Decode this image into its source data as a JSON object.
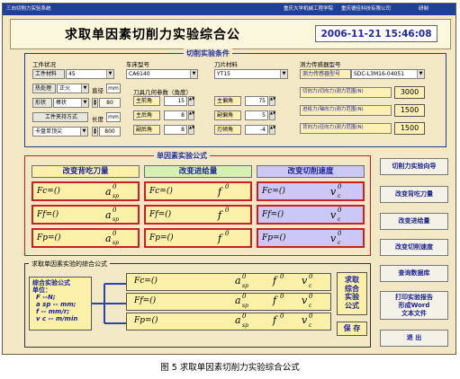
{
  "titlebar": {
    "app": "三向切削力实验系统",
    "org1": "重庆大学机械工程学院",
    "org2": "重庆德佳科技有限公司",
    "mode": "研制"
  },
  "header": {
    "title": "求取单因素切削力实验综合公",
    "datetime": "2006-11-21 15:46:08"
  },
  "conditions": {
    "title": "切削实验条件",
    "workpiece": {
      "label": "工件状况",
      "material_label": "工件材料",
      "material": "45",
      "heat_label": "热处理",
      "heat": "正火",
      "diameter_label": "直径",
      "diameter": "mm",
      "shape_label": "形状",
      "shape": "棒状",
      "shape_value": "80",
      "clamp_label": "工件夹持方式",
      "length_label": "长度",
      "length": "mm",
      "clamp": "卡盘单顶尖",
      "length_value": "800"
    },
    "lathe": {
      "label": "车床型号",
      "model": "CA6140"
    },
    "tool": {
      "label": "刀片材料",
      "material": "YT15"
    },
    "geometry": {
      "label": "刀具几何参数（角度）",
      "rows": [
        {
          "a_label": "主前角",
          "a_value": "15",
          "b_label": "主偏角",
          "b_value": "75"
        },
        {
          "a_label": "主后角",
          "a_value": "8",
          "b_label": "副偏角",
          "b_value": "5"
        },
        {
          "a_label": "副后角",
          "a_value": "8",
          "b_label": "刃倾角",
          "b_value": "-4"
        }
      ]
    },
    "sensor": {
      "label": "测力传感器型号",
      "model_label": "测力传感器型号",
      "model": "SDC-L3M16-04051",
      "ranges": [
        {
          "label": "切向力(切向力)测力范围(N)",
          "value": "3000"
        },
        {
          "label": "进给力(轴向力)测力范围(N)",
          "value": "1500"
        },
        {
          "label": "背向力(径向力)测力范围(N)",
          "value": "1500"
        }
      ]
    }
  },
  "single": {
    "title": "单因素实验公式",
    "columns": [
      {
        "header": "改变背吃刀量",
        "rows": [
          {
            "f": "Fc=()",
            "v": "a",
            "s": "sp",
            "p": "0"
          },
          {
            "f": "Ff=()",
            "v": "a",
            "s": "sp",
            "p": "0"
          },
          {
            "f": "Fp=()",
            "v": "a",
            "s": "sp",
            "p": "0"
          }
        ]
      },
      {
        "header": "改变进给量",
        "rows": [
          {
            "f": "Fc=()",
            "v": "f",
            "s": "",
            "p": "0"
          },
          {
            "f": "Ff=()",
            "v": "f",
            "s": "",
            "p": "0"
          },
          {
            "f": "Fp=()",
            "v": "f",
            "s": "",
            "p": "0"
          }
        ]
      },
      {
        "header": "改变切削速度",
        "rows": [
          {
            "f": "Fc=()",
            "v": "v",
            "s": "c",
            "p": "0"
          },
          {
            "f": "Ff=()",
            "v": "v",
            "s": "c",
            "p": "0"
          },
          {
            "f": "Fp=()",
            "v": "v",
            "s": "c",
            "p": "0"
          }
        ]
      }
    ]
  },
  "combined": {
    "title": "求取单因素实验的综合公式",
    "legend": [
      "综合实验公式",
      "单位：",
      "F --N;",
      "a sp -- mm;",
      "f -- mm/r;",
      "v c -- m/min"
    ],
    "rows": [
      {
        "f": "Fc=()",
        "t1": "a",
        "t1s": "sp",
        "t2": "f",
        "t3": "v",
        "t3s": "c"
      },
      {
        "f": "Ff=()",
        "t1": "a",
        "t1s": "sp",
        "t2": "f",
        "t3": "v",
        "t3s": "c"
      },
      {
        "f": "Fp=()",
        "t1": "a",
        "t1s": "sp",
        "t2": "f",
        "t3": "v",
        "t3s": "c"
      }
    ],
    "solve_label": "求取\n综合\n实验\n公式",
    "save_label": "保 存"
  },
  "sidebar": [
    "切削力实验向导",
    "改变背吃刀量",
    "改变进给量",
    "改变切削速度",
    "查询数据库",
    "打印实验报告\n形成Word\n文本文件",
    "退 出"
  ],
  "caption": "图 5   求取单因素切削力实验综合公式"
}
